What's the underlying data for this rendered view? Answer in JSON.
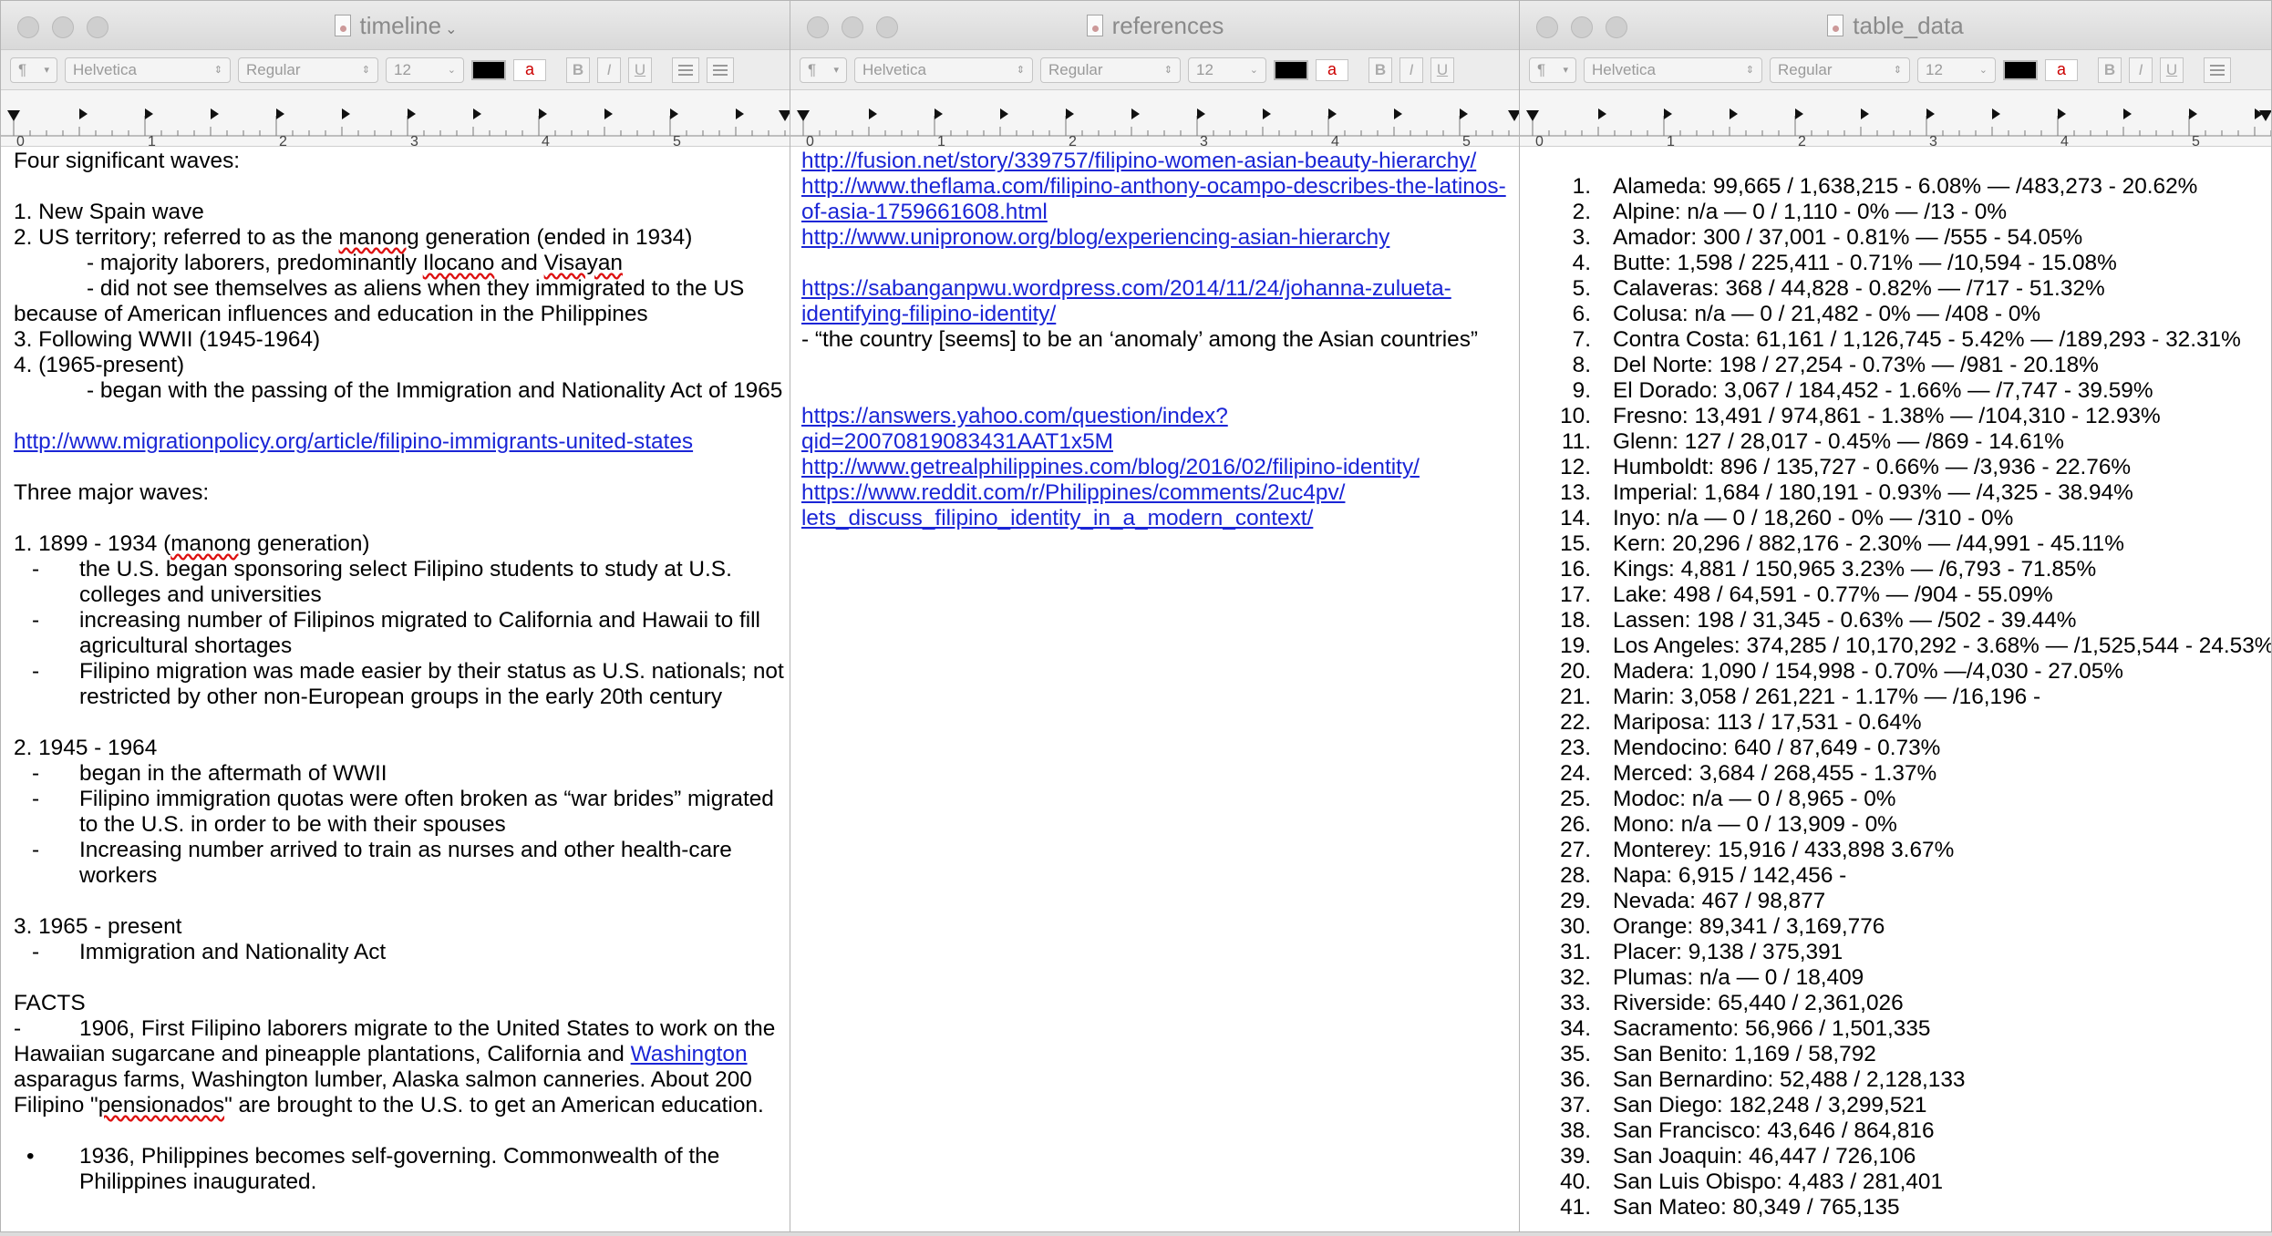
{
  "toolbar": {
    "paragraph_label": "¶",
    "font_family": "Helvetica",
    "font_style": "Regular",
    "font_size": "12",
    "highlight_label": "a",
    "bold": "B",
    "italic": "I",
    "underline": "U"
  },
  "ruler_labels": [
    "0",
    "1",
    "2",
    "3",
    "4",
    "5"
  ],
  "windows": {
    "timeline": {
      "title": "timeline",
      "lines": {
        "l01": "Four significant waves:",
        "l02": "1. New Spain wave",
        "l03a": "2. US territory; referred to as the ",
        "l03b": "manong",
        "l03c": " generation (ended in 1934)",
        "l04a": "- majority laborers, predominantly ",
        "l04b": "Ilocano",
        "l04c": " and ",
        "l04d": "Visayan",
        "l05": "- did not see themselves as aliens when they immigrated to the US",
        "l06": "because of American influences and education in the Philippines",
        "l07": "3. Following WWII (1945-1964)",
        "l08": "4. (1965-present)",
        "l09": "- began with the passing of the Immigration and Nationality Act of 1965",
        "link1": "http://www.migrationpolicy.org/article/filipino-immigrants-united-states",
        "l11": "Three major waves:",
        "l12a": "1. 1899 - 1934 (",
        "l12b": "manong",
        "l12c": " generation)",
        "b1a": "the U.S. began sponsoring select Filipino students to study at U.S.",
        "b1b": "colleges and universities",
        "b2a": "increasing number of Filipinos migrated to California and Hawaii to fill",
        "b2b": "agricultural shortages",
        "b3a": "Filipino migration was made easier by their status as U.S. nationals; not",
        "b3b": "restricted by other non-European groups in the early 20th century",
        "l13": "2. 1945 - 1964",
        "b4": "began in the aftermath of WWII",
        "b5a": "Filipino immigration quotas were often broken as “war brides” migrated",
        "b5b": "to the U.S. in order to be with their spouses",
        "b6a": "Increasing number arrived to train as nurses and other health-care",
        "b6b": "workers",
        "l14": "3. 1965 - present",
        "b7": "Immigration and Nationality Act",
        "l15": "FACTS",
        "f1a": "1906, First Filipino laborers migrate to the United States to work on the",
        "f1b": "Hawaiian sugarcane and pineapple plantations, California and ",
        "f1link": "Washington",
        "f1c": "asparagus farms, Washington lumber, Alaska salmon canneries. About 200",
        "f1d1": "Filipino \"",
        "f1d2": "pensionados",
        "f1d3": "\" are brought to the U.S. to get an American education.",
        "f2a": "1936, Philippines becomes self-governing. Commonwealth of the",
        "f2b": "Philippines inaugurated.",
        "dash": "-",
        "dot": "•"
      }
    },
    "references": {
      "title": "references",
      "r1": "http://fusion.net/story/339757/filipino-women-asian-beauty-hierarchy/",
      "r2a": "http://www.theflama.com/filipino-anthony-ocampo-describes-the-latinos-",
      "r2b": "of-asia-1759661608.html",
      "r3": "http://www.unipronow.org/blog/experiencing-asian-hierarchy",
      "r4a": "https://sabanganpwu.wordpress.com/2014/11/24/johanna-zulueta-",
      "r4b": "identifying-filipino-identity/",
      "quote": "- “the country [seems] to be an ‘anomaly’ among the Asian countries”",
      "r5a": "https://answers.yahoo.com/question/index?",
      "r5b": "qid=20070819083431AAT1x5M",
      "r6": "http://www.getrealphilippines.com/blog/2016/02/filipino-identity/",
      "r7a": "https://www.reddit.com/r/Philippines/comments/2uc4pv/",
      "r7b": "lets_discuss_filipino_identity_in_a_modern_context/"
    },
    "table_data": {
      "title": "table_data",
      "rows": [
        {
          "n": "1.",
          "t": "Alameda: 99,665 / 1,638,215 - 6.08% — /483,273 - 20.62%"
        },
        {
          "n": "2.",
          "t": "Alpine: n/a — 0 / 1,110 - 0% — /13 - 0%"
        },
        {
          "n": "3.",
          "t": "Amador: 300 / 37,001 - 0.81% — /555 - 54.05%"
        },
        {
          "n": "4.",
          "t": "Butte: 1,598 / 225,411 - 0.71% — /10,594 - 15.08%"
        },
        {
          "n": "5.",
          "t": "Calaveras: 368 / 44,828 - 0.82% — /717 - 51.32%"
        },
        {
          "n": "6.",
          "t": "Colusa: n/a — 0 / 21,482 - 0% — /408 - 0%"
        },
        {
          "n": "7.",
          "t": "Contra Costa: 61,161 / 1,126,745 - 5.42% — /189,293 - 32.31%"
        },
        {
          "n": "8.",
          "t": "Del Norte: 198 / 27,254 - 0.73% — /981 - 20.18%"
        },
        {
          "n": "9.",
          "t": "El Dorado: 3,067 / 184,452 - 1.66% — /7,747 - 39.59%"
        },
        {
          "n": "10.",
          "t": "Fresno: 13,491 / 974,861 - 1.38% — /104,310 - 12.93%"
        },
        {
          "n": "11.",
          "t": "Glenn: 127 / 28,017 - 0.45% — /869 - 14.61%"
        },
        {
          "n": "12.",
          "t": "Humboldt: 896 / 135,727 - 0.66% — /3,936 - 22.76%"
        },
        {
          "n": "13.",
          "t": "Imperial: 1,684 / 180,191 - 0.93% — /4,325 - 38.94%"
        },
        {
          "n": "14.",
          "t": "Inyo: n/a — 0 / 18,260 - 0% — /310 - 0%"
        },
        {
          "n": "15.",
          "t": "Kern: 20,296 / 882,176 - 2.30% — /44,991 - 45.11%"
        },
        {
          "n": "16.",
          "t": "Kings: 4,881 / 150,965 3.23% — /6,793 - 71.85%"
        },
        {
          "n": "17.",
          "t": "Lake: 498 / 64,591 - 0.77% — /904 - 55.09%"
        },
        {
          "n": "18.",
          "t": "Lassen: 198 / 31,345 - 0.63% — /502 - 39.44%"
        },
        {
          "n": "19.",
          "t": "Los Angeles: 374,285 / 10,170,292 - 3.68% — /1,525,544 - 24.53%"
        },
        {
          "n": "20.",
          "t": "Madera: 1,090 / 154,998 - 0.70% —/4,030 - 27.05%"
        },
        {
          "n": "21.",
          "t": "Marin: 3,058 / 261,221 - 1.17% — /16,196 -"
        },
        {
          "n": "22.",
          "t": "Mariposa: 113 / 17,531 - 0.64%"
        },
        {
          "n": "23.",
          "t": "Mendocino: 640 / 87,649 - 0.73%"
        },
        {
          "n": "24.",
          "t": "Merced: 3,684 / 268,455 - 1.37%"
        },
        {
          "n": "25.",
          "t": "Modoc: n/a — 0 / 8,965 - 0%"
        },
        {
          "n": "26.",
          "t": "Mono: n/a — 0 / 13,909 - 0%"
        },
        {
          "n": "27.",
          "t": "Monterey: 15,916 / 433,898 3.67%"
        },
        {
          "n": "28.",
          "t": "Napa: 6,915 / 142,456 -"
        },
        {
          "n": "29.",
          "t": "Nevada: 467 / 98,877"
        },
        {
          "n": "30.",
          "t": "Orange: 89,341 / 3,169,776"
        },
        {
          "n": "31.",
          "t": "Placer: 9,138 / 375,391"
        },
        {
          "n": "32.",
          "t": "Plumas: n/a — 0 / 18,409"
        },
        {
          "n": "33.",
          "t": "Riverside: 65,440 / 2,361,026"
        },
        {
          "n": "34.",
          "t": "Sacramento: 56,966 / 1,501,335"
        },
        {
          "n": "35.",
          "t": "San Benito: 1,169 / 58,792"
        },
        {
          "n": "36.",
          "t": "San Bernardino: 52,488 / 2,128,133"
        },
        {
          "n": "37.",
          "t": "San Diego: 182,248 / 3,299,521"
        },
        {
          "n": "38.",
          "t": "San Francisco: 43,646 / 864,816"
        },
        {
          "n": "39.",
          "t": "San Joaquin: 46,447 / 726,106"
        },
        {
          "n": "40.",
          "t": "San Luis Obispo: 4,483 / 281,401"
        },
        {
          "n": "41.",
          "t": "San Mateo: 80,349 / 765,135"
        }
      ]
    }
  },
  "colors": {
    "link": "#1a25d6",
    "spell_underline": "#d11"
  }
}
